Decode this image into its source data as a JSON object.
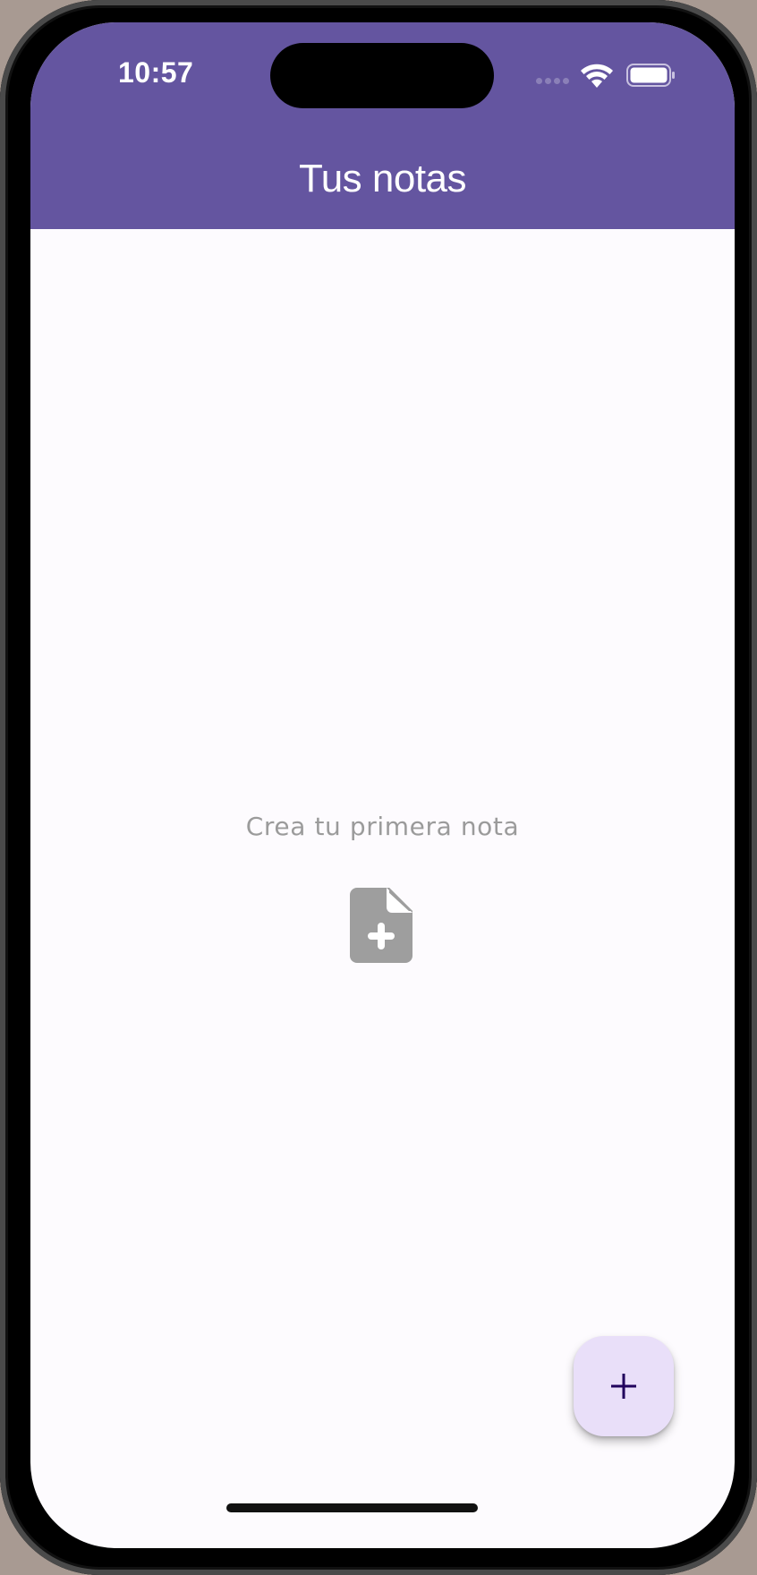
{
  "status_bar": {
    "time": "10:57",
    "icons": [
      "cellular-signal-icon",
      "wifi-icon",
      "battery-icon"
    ]
  },
  "app_bar": {
    "title": "Tus notas",
    "color": "#6455a0"
  },
  "empty_state": {
    "message": "Crea tu primera nota",
    "icon": "note-add-icon",
    "icon_color": "#9e9e9e"
  },
  "fab": {
    "icon": "add-icon",
    "background": "#e9dff9",
    "icon_color": "#21005d"
  }
}
